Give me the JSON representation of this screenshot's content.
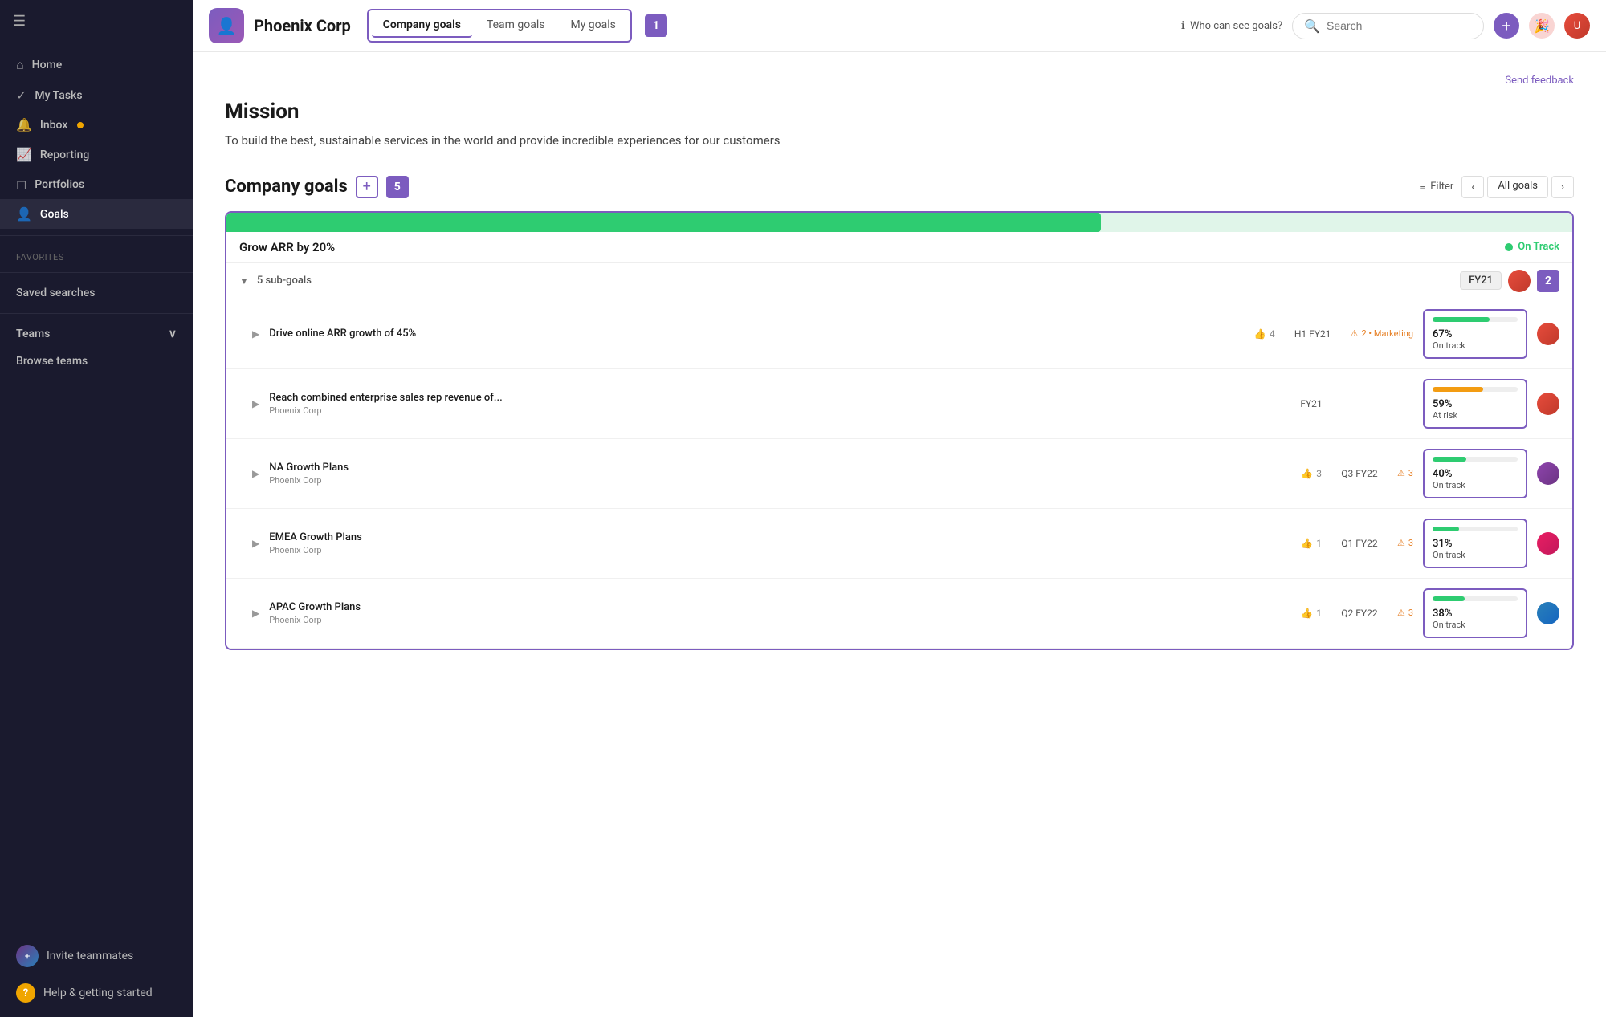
{
  "sidebar": {
    "collapse_label": "☰",
    "nav_items": [
      {
        "id": "home",
        "label": "Home",
        "icon": "⌂",
        "active": false
      },
      {
        "id": "my-tasks",
        "label": "My Tasks",
        "icon": "✓",
        "active": false
      },
      {
        "id": "inbox",
        "label": "Inbox",
        "icon": "🔔",
        "active": false,
        "dot": true
      },
      {
        "id": "reporting",
        "label": "Reporting",
        "icon": "📈",
        "active": false
      },
      {
        "id": "portfolios",
        "label": "Portfolios",
        "icon": "◻",
        "active": false
      },
      {
        "id": "goals",
        "label": "Goals",
        "icon": "👤",
        "active": true
      }
    ],
    "favorites_label": "Favorites",
    "saved_searches_label": "Saved searches",
    "teams_label": "Teams",
    "browse_teams_label": "Browse teams",
    "invite_label": "Invite teammates",
    "help_label": "Help & getting started"
  },
  "header": {
    "org_icon": "👤",
    "title": "Phoenix Corp",
    "tabs": [
      {
        "id": "company-goals",
        "label": "Company goals",
        "active": true
      },
      {
        "id": "team-goals",
        "label": "Team goals",
        "active": false
      },
      {
        "id": "my-goals",
        "label": "My goals",
        "active": false
      }
    ],
    "tab_badge": "1",
    "who_can_see": "Who can see goals?",
    "search_placeholder": "Search",
    "add_icon": "+",
    "send_feedback": "Send feedback"
  },
  "mission": {
    "title": "Mission",
    "text": "To build the best, sustainable services in the world and provide incredible experiences for our customers"
  },
  "company_goals": {
    "title": "Company goals",
    "count": "5",
    "filter_label": "Filter",
    "all_goals_label": "All goals",
    "main_goal": {
      "title": "Grow ARR by 20%",
      "progress_pct": 65,
      "status": "On Track",
      "sub_goals_label": "5 sub-goals",
      "fy_label": "FY21",
      "badge_num": "2",
      "items": [
        {
          "name": "Drive online ARR growth of 45%",
          "sub": "",
          "likes": "4",
          "period": "H1 FY21",
          "warnings": "2",
          "warning_label": "Marketing",
          "progress_pct": 67,
          "progress_color": "green",
          "percent_label": "67%",
          "status_label": "On track",
          "avatar_color": "red"
        },
        {
          "name": "Reach combined enterprise sales rep revenue of...",
          "sub": "Phoenix Corp",
          "likes": "",
          "period": "FY21",
          "warnings": "0",
          "warning_label": "",
          "progress_pct": 59,
          "progress_color": "orange",
          "percent_label": "59%",
          "status_label": "At risk",
          "avatar_color": "red"
        },
        {
          "name": "NA Growth Plans",
          "sub": "Phoenix Corp",
          "likes": "3",
          "period": "Q3 FY22",
          "warnings": "3",
          "warning_label": "",
          "progress_pct": 40,
          "progress_color": "green",
          "percent_label": "40%",
          "status_label": "On track",
          "avatar_color": "purple"
        },
        {
          "name": "EMEA Growth Plans",
          "sub": "Phoenix Corp",
          "likes": "1",
          "period": "Q1 FY22",
          "warnings": "3",
          "warning_label": "",
          "progress_pct": 31,
          "progress_color": "green",
          "percent_label": "31%",
          "status_label": "On track",
          "avatar_color": "pink"
        },
        {
          "name": "APAC Growth Plans",
          "sub": "Phoenix Corp",
          "likes": "1",
          "period": "Q2 FY22",
          "warnings": "3",
          "warning_label": "",
          "progress_pct": 38,
          "progress_color": "green",
          "percent_label": "38%",
          "status_label": "On track",
          "avatar_color": "blue"
        }
      ]
    }
  },
  "badges": {
    "b1": "1",
    "b2": "2",
    "b3": "3",
    "b4": "4",
    "b5": "5"
  }
}
